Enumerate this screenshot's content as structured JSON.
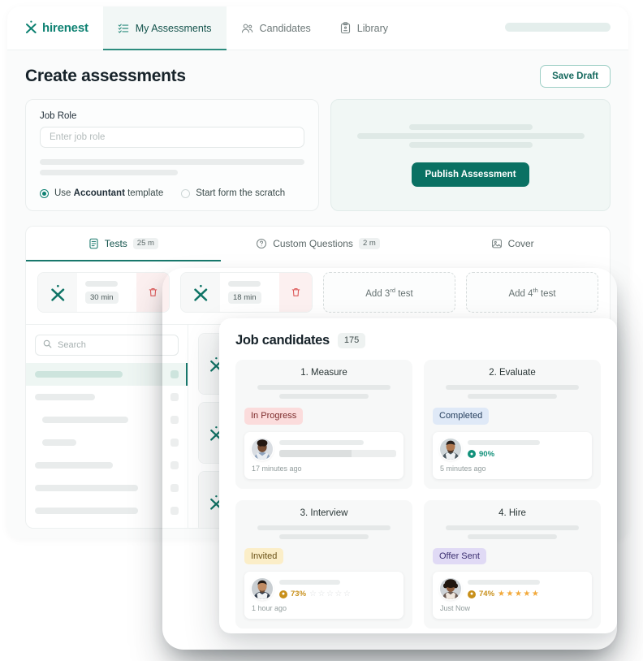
{
  "navbar": {
    "brand": "hirenest",
    "tabs": [
      {
        "label": "My Assessments",
        "icon": "list-check-icon",
        "active": true
      },
      {
        "label": "Candidates",
        "icon": "people-icon",
        "active": false
      },
      {
        "label": "Library",
        "icon": "clipboard-icon",
        "active": false
      }
    ]
  },
  "header": {
    "title": "Create assessments",
    "save_draft_label": "Save Draft"
  },
  "job_role_card": {
    "label": "Job Role",
    "input_placeholder": "Enter job role",
    "input_value": "",
    "options": [
      {
        "prefix": "Use ",
        "strong": "Accountant",
        "suffix": " template",
        "selected": true
      },
      {
        "prefix": "",
        "strong": "",
        "suffix": "Start form the scratch",
        "selected": false
      }
    ]
  },
  "publish_card": {
    "button_label": "Publish Assessment"
  },
  "subtabs": [
    {
      "label": "Tests",
      "chip": "25 m",
      "icon": "tests-icon",
      "active": true
    },
    {
      "label": "Custom Questions",
      "chip": "2 m",
      "icon": "question-circle-icon",
      "active": false
    },
    {
      "label": "Cover",
      "chip": "",
      "icon": "image-icon",
      "active": false
    }
  ],
  "tests": [
    {
      "duration": "30 min",
      "delete_icon": "trash-icon"
    },
    {
      "duration": "18 min",
      "delete_icon": "trash-icon"
    }
  ],
  "add_tests": [
    {
      "prefix": "Add 3",
      "sup": "rd",
      "suffix": " test"
    },
    {
      "prefix": "Add 4",
      "sup": "th",
      "suffix": " test"
    }
  ],
  "search": {
    "placeholder": "Search",
    "icon": "search-icon"
  },
  "modal": {
    "title": "Job candidates",
    "count": "175",
    "stages": [
      {
        "title": "1. Measure",
        "status": "In Progress",
        "status_bg": "#fbdcdc",
        "status_color": "#7c2b2b",
        "time": "17 minutes ago",
        "has_progress": true,
        "progress_pct": 62,
        "score": "",
        "stars_filled": 0,
        "stars_total": 0,
        "avatar": "candidate-avatar-1"
      },
      {
        "title": "2. Evaluate",
        "status": "Completed",
        "status_bg": "#dfe9f7",
        "status_color": "#27405e",
        "time": "5 minutes ago",
        "has_progress": false,
        "progress_pct": 0,
        "score": "90%",
        "score_color": "#12917b",
        "stars_filled": 0,
        "stars_total": 0,
        "avatar": "candidate-avatar-2"
      },
      {
        "title": "3. Interview",
        "status": "Invited",
        "status_bg": "#fbeec8",
        "status_color": "#6a5218",
        "time": "1 hour ago",
        "has_progress": false,
        "progress_pct": 0,
        "score": "73%",
        "score_color": "#c8901b",
        "stars_filled": 0,
        "stars_total": 5,
        "avatar": "candidate-avatar-3"
      },
      {
        "title": "4. Hire",
        "status": "Offer Sent",
        "status_bg": "#e0daf5",
        "status_color": "#3c3071",
        "time": "Just Now",
        "has_progress": false,
        "progress_pct": 0,
        "score": "74%",
        "score_color": "#c8901b",
        "stars_filled": 5,
        "stars_total": 5,
        "avatar": "candidate-avatar-4"
      }
    ]
  },
  "colors": {
    "brand_green": "#0f8273",
    "primary_button": "#0a7163",
    "accent_border": "#9ecfc6"
  }
}
